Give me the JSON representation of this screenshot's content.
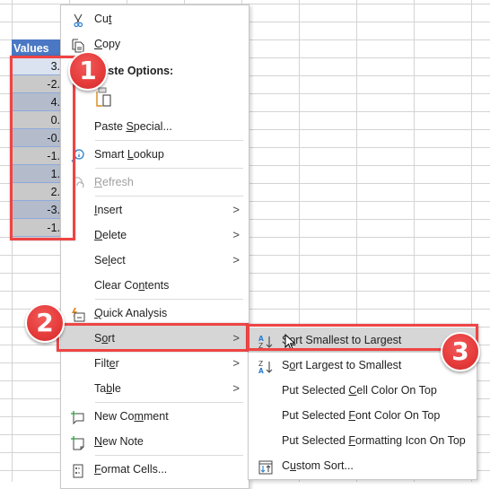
{
  "spreadsheet": {
    "column_header": "Values",
    "cells": [
      "3.",
      "-2.",
      "4.",
      "0.",
      "-0.",
      "-1.",
      "1.",
      "2.",
      "-3.",
      "-1."
    ]
  },
  "context_menu": {
    "items": [
      {
        "label_pre": "Cu",
        "accel": "t",
        "label_post": "",
        "icon": "scissors-icon"
      },
      {
        "label_pre": "",
        "accel": "C",
        "label_post": "opy",
        "icon": "copy-icon"
      },
      {
        "label": "Paste Options:",
        "icon": "none"
      },
      {
        "label": "",
        "icon": "paste-icon"
      },
      {
        "label_pre": "Paste ",
        "accel": "S",
        "label_post": "pecial...",
        "icon": "none"
      },
      {
        "label_pre": "Smart ",
        "accel": "L",
        "label_post": "ookup",
        "icon": "smart-lookup-icon"
      },
      {
        "label_pre": "",
        "accel": "R",
        "label_post": "efresh",
        "icon": "refresh-icon",
        "disabled": true
      },
      {
        "label_pre": "",
        "accel": "I",
        "label_post": "nsert",
        "submenu": true
      },
      {
        "label_pre": "",
        "accel": "D",
        "label_post": "elete",
        "submenu": true
      },
      {
        "label_pre": "Se",
        "accel": "l",
        "label_post": "ect",
        "submenu": true
      },
      {
        "label_pre": "Clear Co",
        "accel": "n",
        "label_post": "tents"
      },
      {
        "label_pre": "",
        "accel": "Q",
        "label_post": "uick Analysis",
        "icon": "quick-analysis-icon"
      },
      {
        "label_pre": "S",
        "accel": "o",
        "label_post": "rt",
        "submenu": true,
        "highlighted": true
      },
      {
        "label_pre": "Filt",
        "accel": "e",
        "label_post": "r",
        "submenu": true
      },
      {
        "label_pre": "Ta",
        "accel": "b",
        "label_post": "le",
        "submenu": true
      },
      {
        "label_pre": "New Co",
        "accel": "m",
        "label_post": "ment",
        "icon": "new-comment-icon"
      },
      {
        "label_pre": "",
        "accel": "N",
        "label_post": "ew Note",
        "icon": "new-note-icon"
      },
      {
        "label_pre": "",
        "accel": "F",
        "label_post": "ormat Cells...",
        "icon": "format-cells-icon"
      }
    ],
    "submenu_arrow": ">"
  },
  "sort_submenu": {
    "items": [
      {
        "label_pre": "S",
        "accel": "o",
        "label_post": "rt Smallest to Largest",
        "icon": "sort-ascending-icon",
        "highlighted": true
      },
      {
        "label_pre": "S",
        "accel": "o",
        "label_post": "rt Largest to Smallest",
        "icon": "sort-descending-icon"
      },
      {
        "label_pre": "Put Selected ",
        "accel": "C",
        "label_post": "ell Color On Top"
      },
      {
        "label_pre": "Put Selected ",
        "accel": "F",
        "label_post": "ont Color On Top"
      },
      {
        "label_pre": "Put Selected ",
        "accel": "F",
        "label_post": "ormatting Icon On Top"
      },
      {
        "label_pre": "C",
        "accel": "u",
        "label_post": "stom Sort...",
        "icon": "custom-sort-icon"
      }
    ]
  },
  "annotations": {
    "badges": [
      "1",
      "2",
      "3"
    ],
    "highlight_color": "#ef4444"
  },
  "colors": {
    "header_blue": "#4a78c4",
    "badge_red": "#e53a3a"
  }
}
